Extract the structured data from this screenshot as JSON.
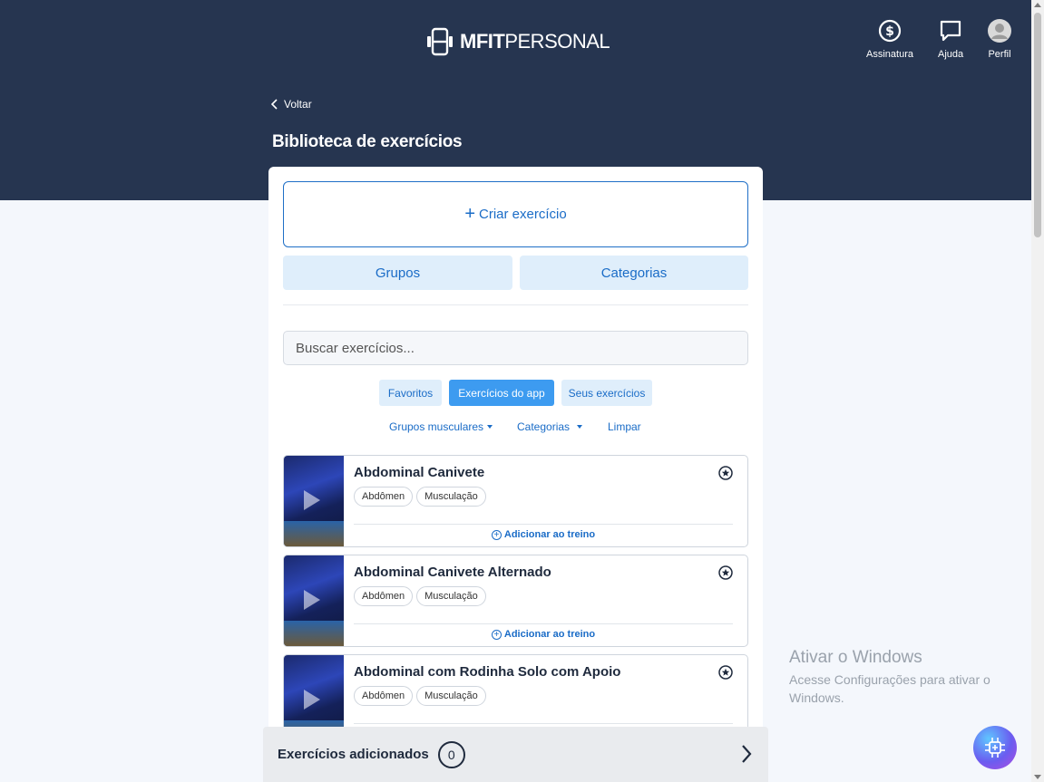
{
  "header": {
    "logo_bold": "MFIT",
    "logo_light": "PERSONAL",
    "nav": [
      {
        "label": "Assinatura",
        "icon": "dollar-circle-icon"
      },
      {
        "label": "Ajuda",
        "icon": "chat-bubble-icon"
      },
      {
        "label": "Perfil",
        "icon": "avatar-icon"
      }
    ],
    "back_label": "Voltar",
    "page_title": "Biblioteca de exercícios"
  },
  "library": {
    "create_label": "Criar exercício",
    "segments": [
      "Grupos",
      "Categorias"
    ],
    "search_placeholder": "Buscar exercícios...",
    "chips": [
      {
        "label": "Favoritos",
        "active": false
      },
      {
        "label": "Exercícios do app",
        "active": true
      },
      {
        "label": "Seus exercícios",
        "active": false
      }
    ],
    "filters": {
      "muscle_groups": "Grupos musculares",
      "categories": "Categorias",
      "clear": "Limpar"
    },
    "add_label": "Adicionar ao treino",
    "exercises": [
      {
        "title": "Abdominal Canivete",
        "tags": [
          "Abdômen",
          "Musculação"
        ]
      },
      {
        "title": "Abdominal Canivete Alternado",
        "tags": [
          "Abdômen",
          "Musculação"
        ]
      },
      {
        "title": "Abdominal com Rodinha Solo com Apoio",
        "tags": [
          "Abdômen",
          "Musculação"
        ]
      }
    ]
  },
  "bottom_bar": {
    "label": "Exercícios adicionados",
    "count": "0"
  },
  "watermark": {
    "title": "Ativar o Windows",
    "subtitle": "Acesse Configurações para ativar o Windows."
  },
  "colors": {
    "header_bg": "#263550",
    "accent": "#1a6cc7",
    "chip_active": "#3d9bf0"
  }
}
